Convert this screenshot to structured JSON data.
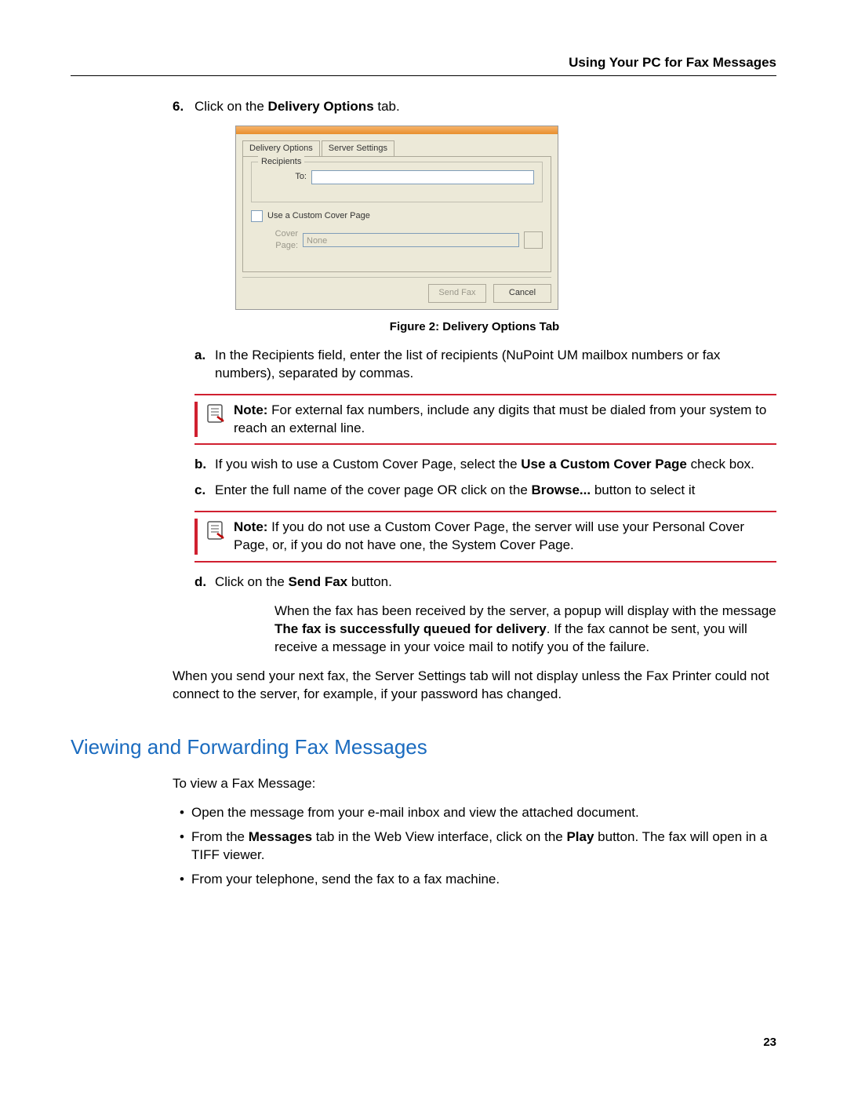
{
  "header": {
    "title": "Using Your PC for Fax Messages"
  },
  "step6": {
    "num": "6.",
    "text_pre": "Click on the ",
    "text_bold": "Delivery Options",
    "text_post": " tab."
  },
  "dialog": {
    "tab_active": "Delivery Options",
    "tab_inactive": "Server Settings",
    "fieldset_legend": "Recipients",
    "to_label": "To:",
    "cover_chk_label": "Use a Custom Cover Page",
    "cover_page_label": "Cover Page:",
    "cover_page_value": "None",
    "btn_send": "Send Fax",
    "btn_cancel": "Cancel"
  },
  "figcaption": "Figure 2: Delivery Options Tab",
  "sub_a": {
    "lab": "a.",
    "text": "In the Recipients field, enter the list of recipients (NuPoint UM mailbox numbers or fax numbers), separated by commas."
  },
  "note1": {
    "bold": "Note:",
    "text": " For external fax numbers, include any digits that must be dialed from your system to reach an external line."
  },
  "sub_b": {
    "lab": "b.",
    "pre": "If you wish to use a Custom Cover Page, select the ",
    "bold": "Use a Custom Cover Page",
    "post": " check box."
  },
  "sub_c": {
    "lab": "c.",
    "pre": "Enter the full name of the cover page OR click on the ",
    "bold": "Browse...",
    "post": " button to select it"
  },
  "note2": {
    "bold": "Note:",
    "text": " If you do not use a Custom Cover Page, the server will use your Personal Cover Page, or, if you do not have one, the System Cover Page."
  },
  "sub_d": {
    "lab": "d.",
    "pre": "Click on the ",
    "bold": "Send Fax",
    "post": " button."
  },
  "para1": {
    "pre": "When the fax has been received by the server, a popup will display with the message ",
    "bold": "The fax is successfully queued for delivery",
    "post": ". If the fax cannot be sent, you will receive a message in your voice mail to notify you of the failure."
  },
  "para2": "When you send your next fax, the Server Settings tab will not display unless the Fax Printer could not connect to the server, for example, if your password has changed.",
  "section_title": "Viewing and Forwarding Fax Messages",
  "view_intro": "To view a Fax Message:",
  "bullets": {
    "b1": "Open the message from your e-mail inbox and view the attached document.",
    "b2_pre": "From the ",
    "b2_bold1": "Messages",
    "b2_mid": " tab in the Web View interface, click on the ",
    "b2_bold2": "Play",
    "b2_post": " button. The fax will open in a TIFF viewer.",
    "b3": "From your telephone, send the fax to a fax machine."
  },
  "page_number": "23"
}
